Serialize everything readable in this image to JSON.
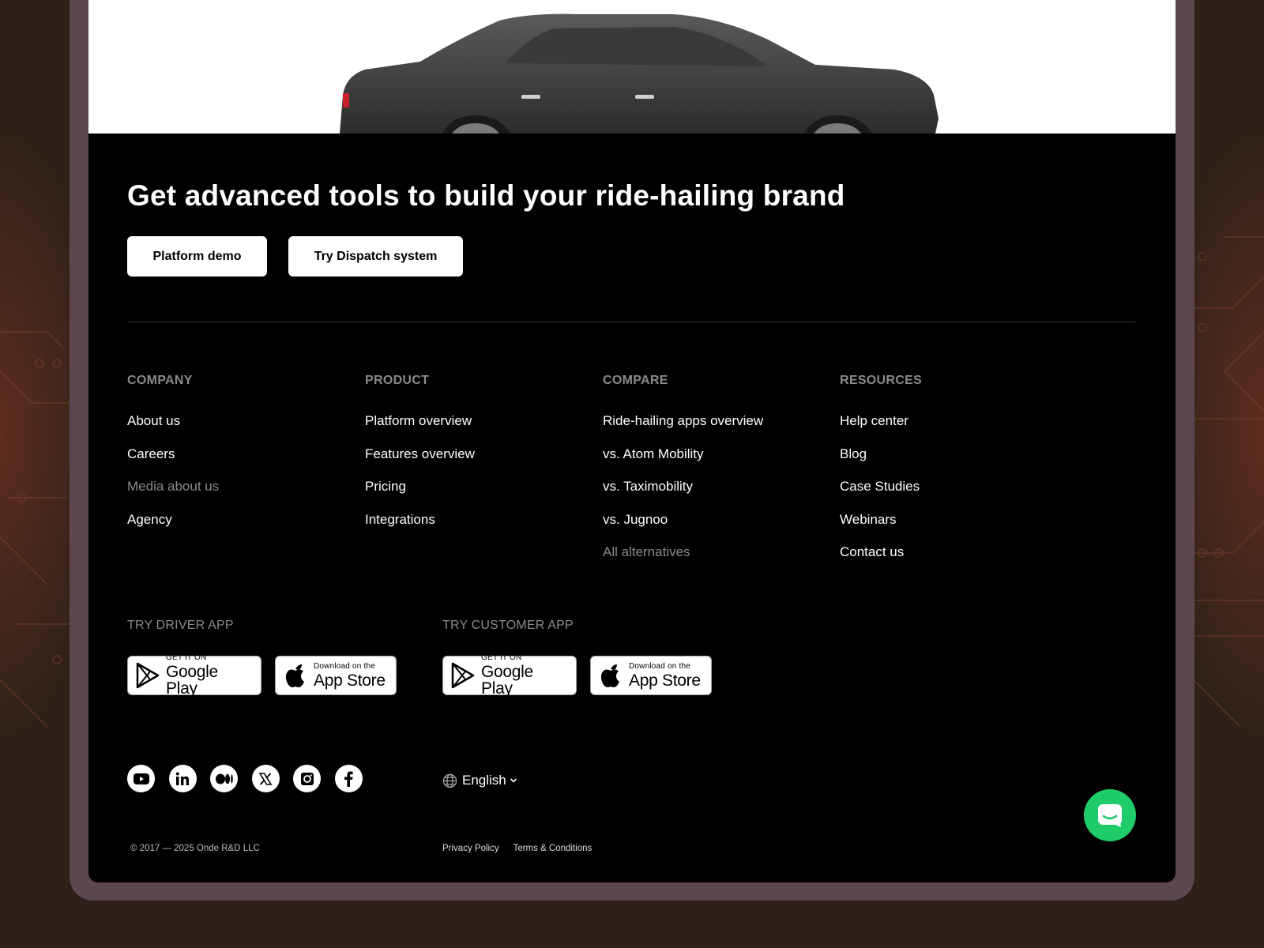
{
  "cta": {
    "title": "Get advanced tools to build your ride-hailing brand",
    "demo_button": "Platform demo",
    "dispatch_button": "Try Dispatch system"
  },
  "columns": [
    {
      "heading": "COMPANY",
      "items": [
        {
          "label": "About us",
          "muted": false
        },
        {
          "label": "Careers",
          "muted": false
        },
        {
          "label": "Media about us",
          "muted": true
        },
        {
          "label": "Agency",
          "muted": false
        }
      ]
    },
    {
      "heading": "PRODUCT",
      "items": [
        {
          "label": "Platform overview",
          "muted": false
        },
        {
          "label": "Features overview",
          "muted": false
        },
        {
          "label": "Pricing",
          "muted": false
        },
        {
          "label": "Integrations",
          "muted": false
        }
      ]
    },
    {
      "heading": "COMPARE",
      "items": [
        {
          "label": "Ride-hailing apps overview",
          "muted": false
        },
        {
          "label": "vs. Atom Mobility",
          "muted": false
        },
        {
          "label": "vs. Taximobility",
          "muted": false
        },
        {
          "label": "vs. Jugnoo",
          "muted": false
        },
        {
          "label": "All alternatives",
          "muted": true
        }
      ]
    },
    {
      "heading": "RESOURCES",
      "items": [
        {
          "label": "Help center",
          "muted": false
        },
        {
          "label": "Blog",
          "muted": false
        },
        {
          "label": "Case Studies",
          "muted": false
        },
        {
          "label": "Webinars",
          "muted": false
        },
        {
          "label": "Contact us",
          "muted": false
        }
      ]
    }
  ],
  "apps": {
    "driver_heading": "TRY DRIVER APP",
    "customer_heading": "TRY CUSTOMER APP",
    "google_small": "GET IT ON",
    "google_big": "Google Play",
    "apple_small": "Download on the",
    "apple_big": "App Store"
  },
  "socials": [
    "youtube-icon",
    "linkedin-icon",
    "medium-icon",
    "x-icon",
    "instagram-icon",
    "facebook-icon"
  ],
  "language": {
    "current": "English"
  },
  "copyright": "© 2017 — 2025 Onde R&D LLC",
  "legal": {
    "privacy": "Privacy Policy",
    "terms": "Terms & Conditions"
  },
  "colors": {
    "chat_button": "#1fcc6a",
    "muted_text": "#8a8a8a",
    "footer_bg": "#000000"
  }
}
